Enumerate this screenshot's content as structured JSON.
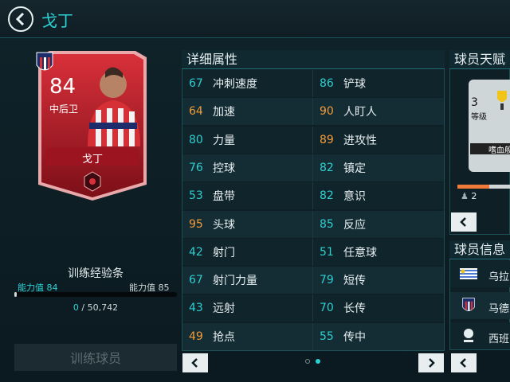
{
  "header": {
    "title": "戈丁"
  },
  "card": {
    "rating": "84",
    "position": "中后卫",
    "name": "戈丁"
  },
  "training": {
    "title": "训练经验条",
    "ability_left_label": "能力值",
    "ability_left_value": "84",
    "ability_right_label": "能力值",
    "ability_right_value": "85",
    "xp_current": "0",
    "xp_separator": "/",
    "xp_total": "50,742",
    "progress": 0,
    "button_label": "训练球员"
  },
  "attributes": {
    "title": "详细属性",
    "rows": [
      {
        "lv": "67",
        "ln": "冲刺速度",
        "lc": "#2ecfd0",
        "rv": "86",
        "rn": "铲球",
        "rc": "#2ecfd0"
      },
      {
        "lv": "64",
        "ln": "加速",
        "lc": "#f29c3a",
        "rv": "90",
        "rn": "人盯人",
        "rc": "#f29c3a"
      },
      {
        "lv": "80",
        "ln": "力量",
        "lc": "#2ecfd0",
        "rv": "89",
        "rn": "进攻性",
        "rc": "#f29c3a"
      },
      {
        "lv": "76",
        "ln": "控球",
        "lc": "#2ecfd0",
        "rv": "82",
        "rn": "镇定",
        "rc": "#2ecfd0"
      },
      {
        "lv": "53",
        "ln": "盘带",
        "lc": "#2ecfd0",
        "rv": "82",
        "rn": "意识",
        "rc": "#2ecfd0"
      },
      {
        "lv": "95",
        "ln": "头球",
        "lc": "#f29c3a",
        "rv": "85",
        "rn": "反应",
        "rc": "#2ecfd0"
      },
      {
        "lv": "42",
        "ln": "射门",
        "lc": "#2ecfd0",
        "rv": "51",
        "rn": "任意球",
        "rc": "#2ecfd0"
      },
      {
        "lv": "67",
        "ln": "射门力量",
        "lc": "#2ecfd0",
        "rv": "79",
        "rn": "短传",
        "rc": "#2ecfd0"
      },
      {
        "lv": "43",
        "ln": "远射",
        "lc": "#2ecfd0",
        "rv": "70",
        "rn": "长传",
        "rc": "#2ecfd0"
      },
      {
        "lv": "49",
        "ln": "抢点",
        "lc": "#f29c3a",
        "rv": "55",
        "rn": "传中",
        "rc": "#2ecfd0"
      }
    ]
  },
  "talent": {
    "title": "球员天赋",
    "level_number": "3",
    "level_label": "等级",
    "skill_name": "嗜血般",
    "count": "2"
  },
  "info": {
    "title": "球员信息",
    "rows": [
      {
        "label": "乌拉"
      },
      {
        "label": "马德"
      },
      {
        "label": "西班"
      }
    ]
  },
  "colors": {
    "accent": "#2ad2d4",
    "highlight": "#f29c3a",
    "card_red": "#b3212d"
  }
}
